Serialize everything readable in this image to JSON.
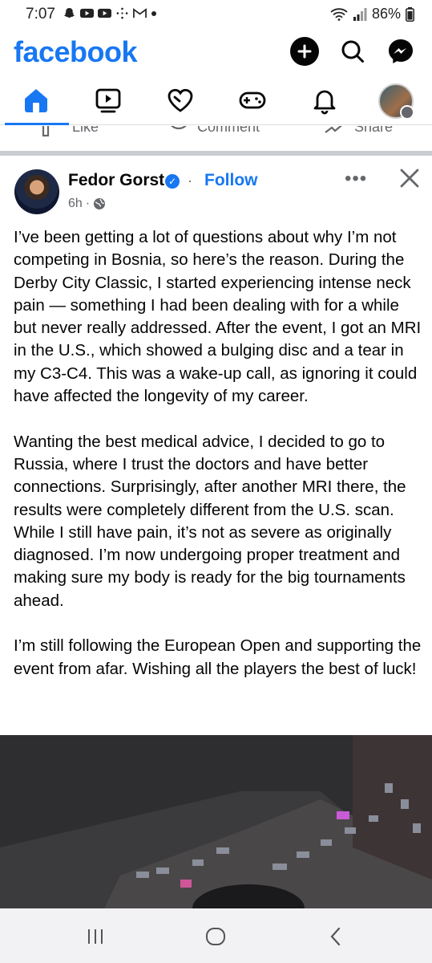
{
  "status_bar": {
    "time": "7:07",
    "battery": "86%",
    "icons": [
      "snapchat-icon",
      "youtube-icon",
      "youtube-icon",
      "sparkle-icon",
      "gmail-icon",
      "dot-icon",
      "wifi-icon",
      "signal-icon",
      "battery-icon"
    ]
  },
  "header": {
    "logo": "facebook",
    "brand_color": "#1877f2",
    "actions": [
      "create-icon",
      "search-icon",
      "messenger-icon"
    ]
  },
  "tabs": [
    {
      "name": "home",
      "icon": "home-icon",
      "active": true
    },
    {
      "name": "video",
      "icon": "video-icon",
      "active": false
    },
    {
      "name": "dating",
      "icon": "heart-icon",
      "active": false
    },
    {
      "name": "gaming",
      "icon": "gamepad-icon",
      "active": false
    },
    {
      "name": "notifications",
      "icon": "bell-icon",
      "active": false
    },
    {
      "name": "profile-menu",
      "icon": "avatar-icon",
      "active": false
    }
  ],
  "previous_post": {
    "like_label": "Like",
    "comment_label": "Comment",
    "share_label": "Share"
  },
  "post": {
    "author": "Fedor Gorst",
    "follow_label": "Follow",
    "timestamp": "6h",
    "audience_icon": "globe-icon",
    "paragraphs": [
      "I’ve been getting a lot of questions about why I’m not competing in Bosnia, so here’s the reason. During the Derby City Classic, I started experiencing intense neck pain — something I had been dealing with for a while but never really addressed. After the event, I got an MRI in the U.S., which showed a bulging disc and a tear in my C3-C4. This was a wake-up call, as ignoring it could have affected the longevity of my career.",
      "Wanting the best medical advice, I decided to go to Russia, where I trust the doctors and have better connections. Surprisingly, after another MRI there, the results were completely different from the U.S. scan. While I still have pain, it’s not as severe as originally diagnosed. I’m now undergoing proper treatment and making sure my body is ready for the big tournaments ahead.",
      "I’m still following the European Open and supporting the event from afar. Wishing all the players the best of luck!"
    ]
  },
  "android_nav": [
    "recents-icon",
    "home-circle-icon",
    "back-icon"
  ]
}
